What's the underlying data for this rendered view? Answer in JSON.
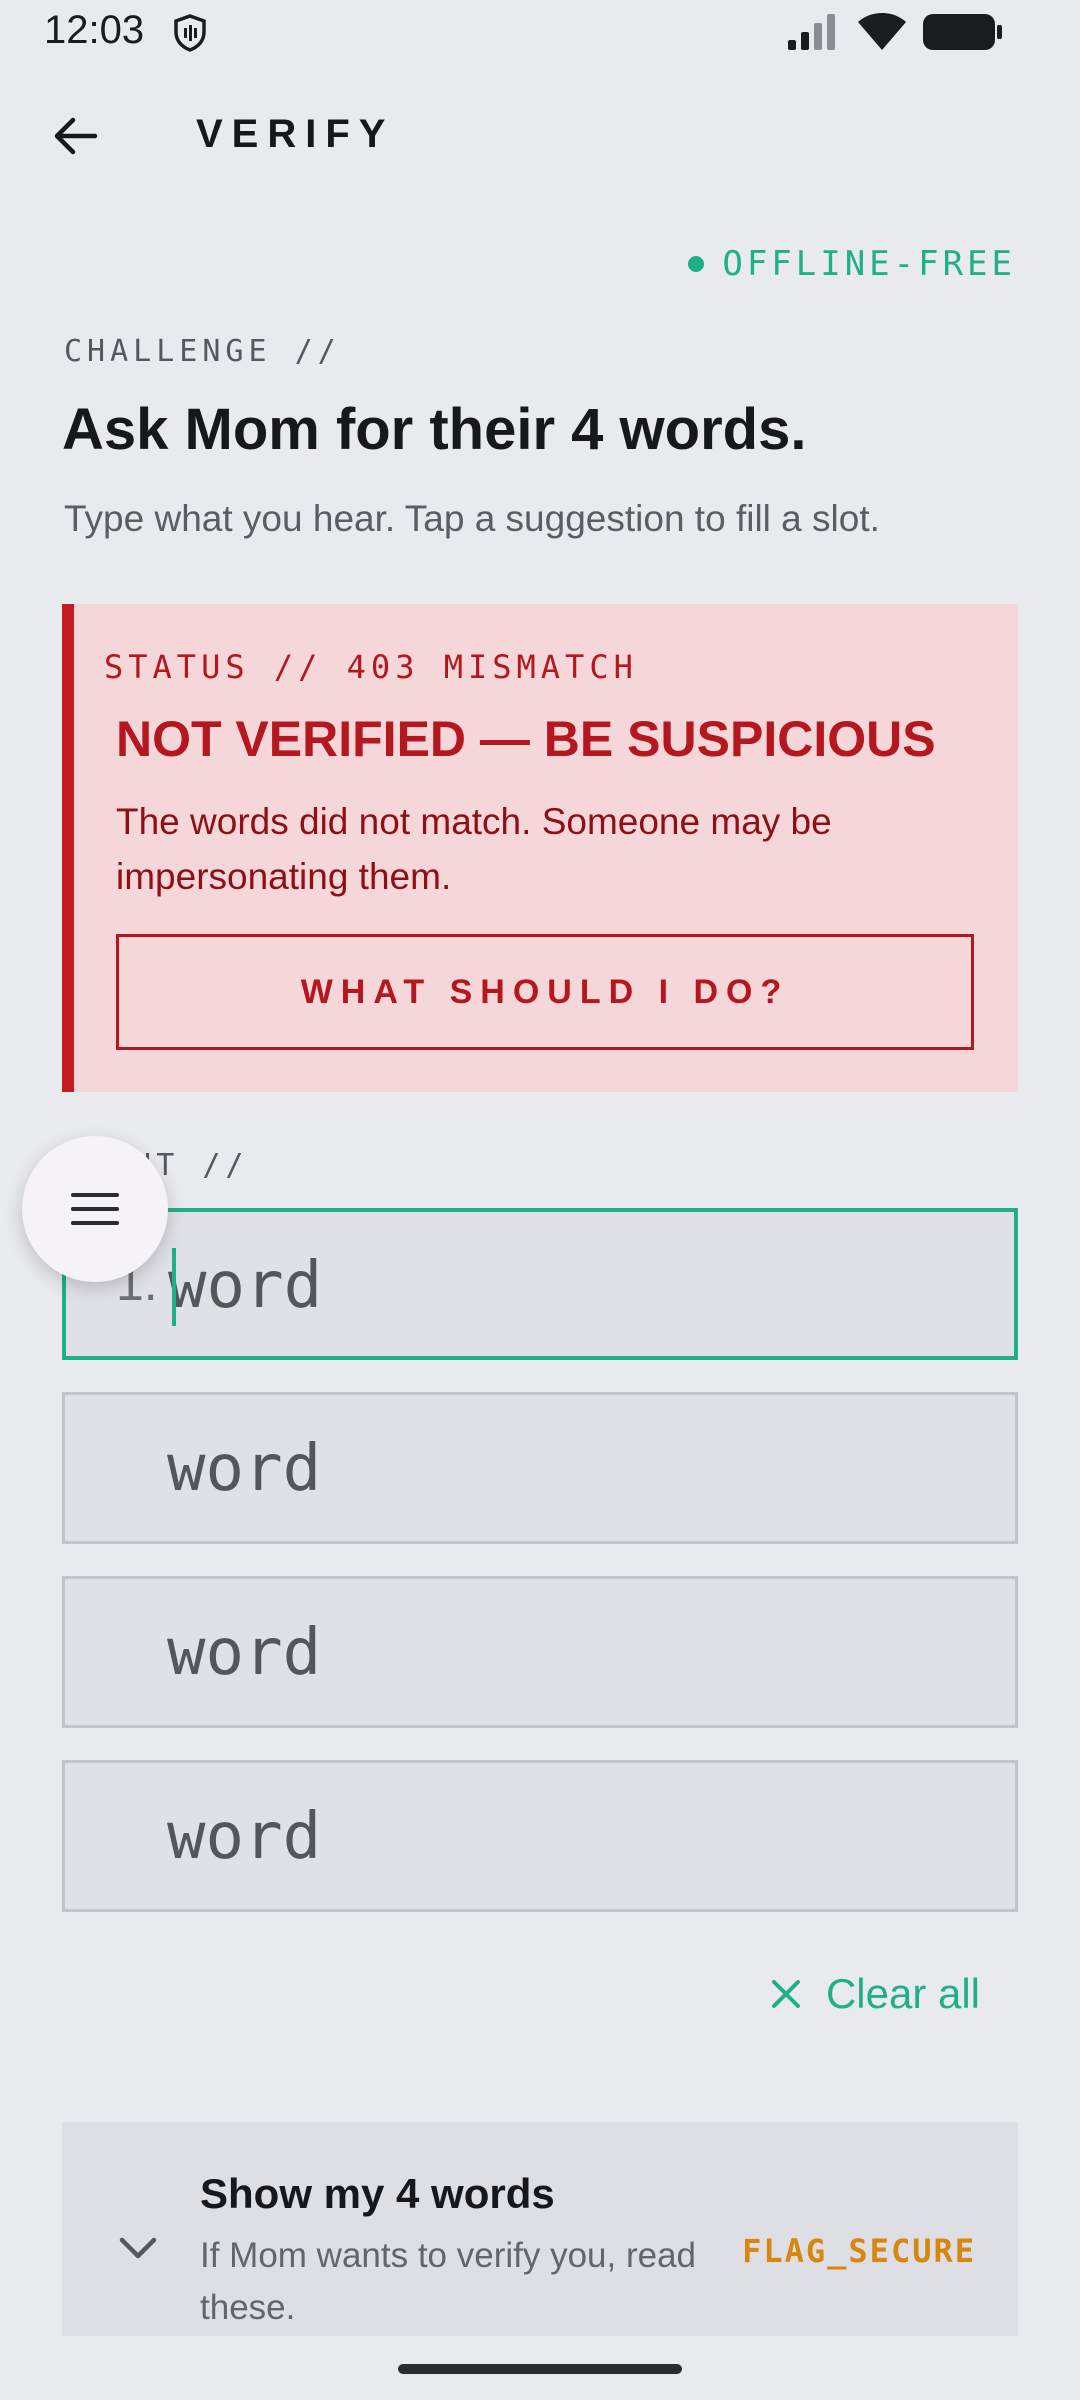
{
  "status_bar": {
    "time": "12:03",
    "icons": [
      "shield-icon",
      "signal-icon",
      "wifi-icon",
      "battery-icon"
    ]
  },
  "app_bar": {
    "title": "VERIFY",
    "back_icon": "arrow-left-icon"
  },
  "badge": {
    "label": "OFFLINE-FREE",
    "color": "#1fb185"
  },
  "challenge": {
    "label": "CHALLENGE //",
    "title": "Ask Mom for their 4 words.",
    "subtitle": "Type what you hear. Tap a suggestion to fill a slot."
  },
  "alert": {
    "status": "STATUS // 403 MISMATCH",
    "title": "NOT VERIFIED — BE SUSPICIOUS",
    "body": "The words did not match. Someone may be impersonating them.",
    "button_label": "WHAT SHOULD I DO?",
    "color": "#c21d24"
  },
  "input": {
    "label": "INPUT //",
    "slots": [
      {
        "number": "1.",
        "value": "",
        "placeholder": "word"
      },
      {
        "number": "",
        "value": "",
        "placeholder": "word"
      },
      {
        "number": "",
        "value": "",
        "placeholder": "word"
      },
      {
        "number": "",
        "value": "",
        "placeholder": "word"
      }
    ],
    "clear_label": "Clear all"
  },
  "words_panel": {
    "title": "Show my 4 words",
    "description": "If Mom wants to verify you, read these.",
    "flag": "FLAG_SECURE"
  },
  "fab": {
    "icon": "menu-icon"
  }
}
